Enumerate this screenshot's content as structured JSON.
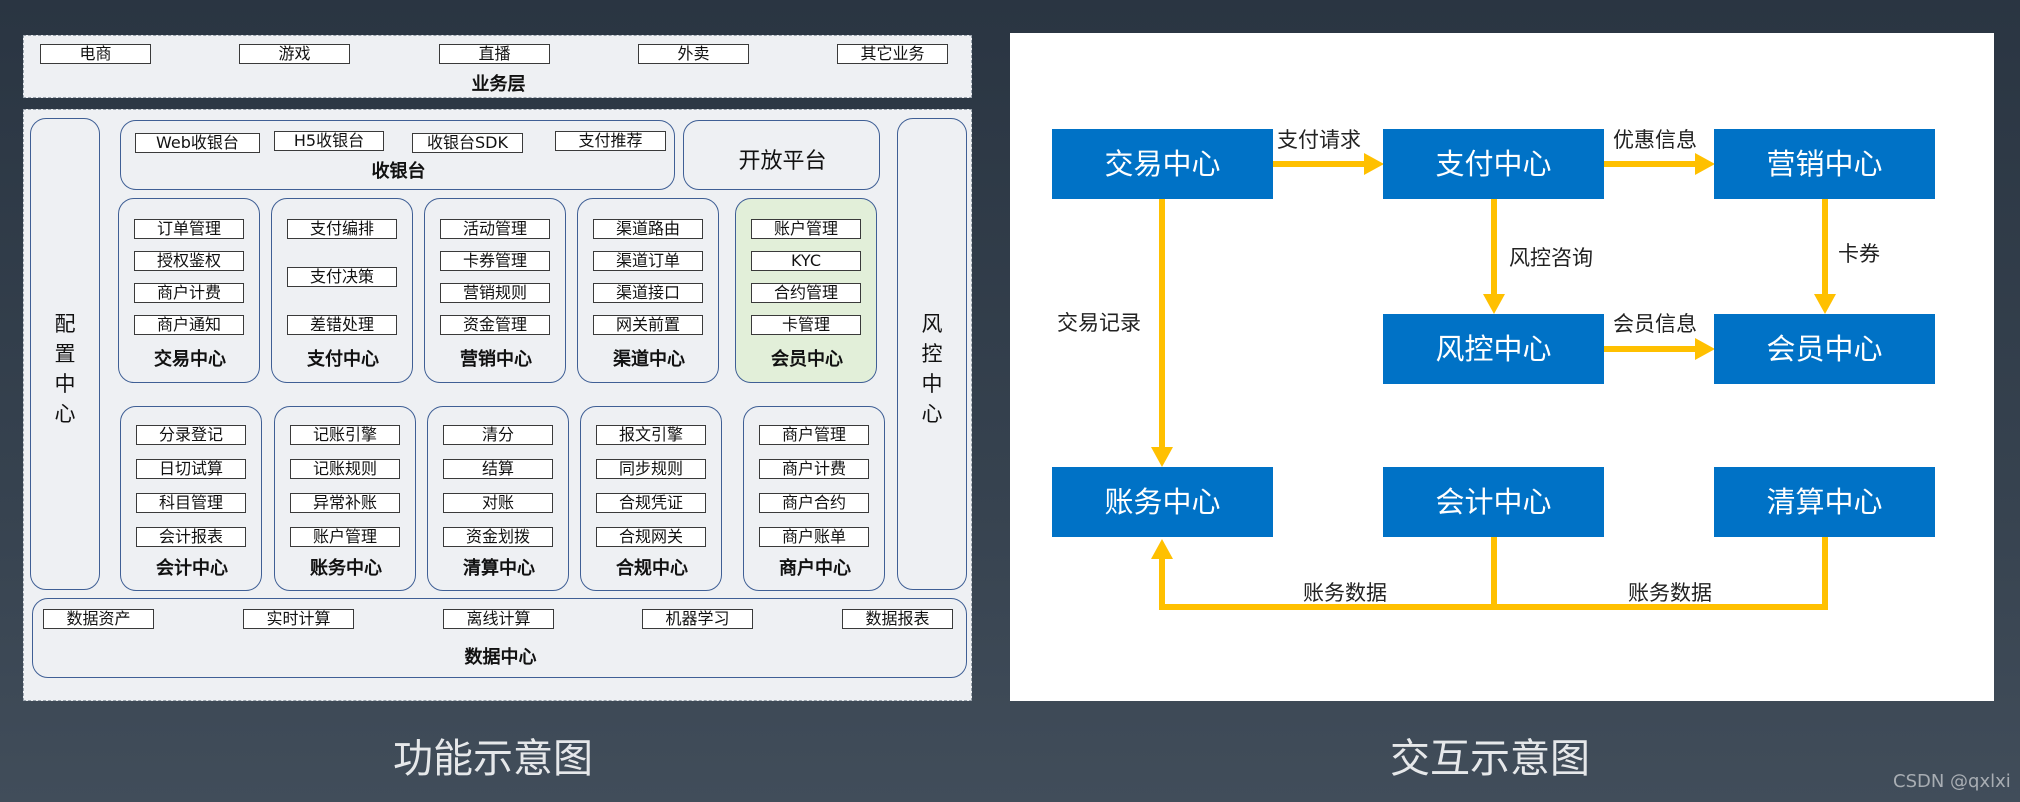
{
  "business_layer": {
    "title": "业务层",
    "items": [
      "电商",
      "游戏",
      "直播",
      "外卖",
      "其它业务"
    ]
  },
  "config_center": {
    "label": "配置中心"
  },
  "risk_center_side": {
    "label": "风控中心"
  },
  "cashier": {
    "title": "收银台",
    "items": [
      "Web收银台",
      "H5收银台",
      "收银台SDK",
      "支付推荐"
    ]
  },
  "open_platform": {
    "label": "开放平台"
  },
  "centers_row1": [
    {
      "title": "交易中心",
      "items": [
        "订单管理",
        "授权鉴权",
        "商户计费",
        "商户通知"
      ]
    },
    {
      "title": "支付中心",
      "items": [
        "支付编排",
        "支付决策",
        "差错处理"
      ]
    },
    {
      "title": "营销中心",
      "items": [
        "活动管理",
        "卡券管理",
        "营销规则",
        "资金管理"
      ]
    },
    {
      "title": "渠道中心",
      "items": [
        "渠道路由",
        "渠道订单",
        "渠道接口",
        "网关前置"
      ]
    },
    {
      "title": "会员中心",
      "items": [
        "账户管理",
        "KYC",
        "合约管理",
        "卡管理"
      ]
    }
  ],
  "centers_row2": [
    {
      "title": "会计中心",
      "items": [
        "分录登记",
        "日切试算",
        "科目管理",
        "会计报表"
      ]
    },
    {
      "title": "账务中心",
      "items": [
        "记账引擎",
        "记账规则",
        "异常补账",
        "账户管理"
      ]
    },
    {
      "title": "清算中心",
      "items": [
        "清分",
        "结算",
        "对账",
        "资金划拨"
      ]
    },
    {
      "title": "合规中心",
      "items": [
        "报文引擎",
        "同步规则",
        "合规凭证",
        "合规网关"
      ]
    },
    {
      "title": "商户中心",
      "items": [
        "商户管理",
        "商户计费",
        "商户合约",
        "商户账单"
      ]
    }
  ],
  "data_center": {
    "title": "数据中心",
    "items": [
      "数据资产",
      "实时计算",
      "离线计算",
      "机器学习",
      "数据报表"
    ]
  },
  "interaction": {
    "nodes": {
      "trade": "交易中心",
      "pay": "支付中心",
      "marketing": "营销中心",
      "risk": "风控中心",
      "member": "会员中心",
      "ledger": "账务中心",
      "accounting": "会计中心",
      "settlement": "清算中心"
    },
    "edge_labels": {
      "pay_request": "支付请求",
      "discount_info": "优惠信息",
      "risk_query": "风控咨询",
      "coupon": "卡券",
      "member_info": "会员信息",
      "trade_record": "交易记录",
      "ledger_data_1": "账务数据",
      "ledger_data_2": "账务数据"
    },
    "arrow_color": "#ffc000",
    "node_color": "#0072c6"
  },
  "captions": {
    "left": "功能示意图",
    "right": "交互示意图"
  },
  "watermark": "CSDN @qxlxi"
}
